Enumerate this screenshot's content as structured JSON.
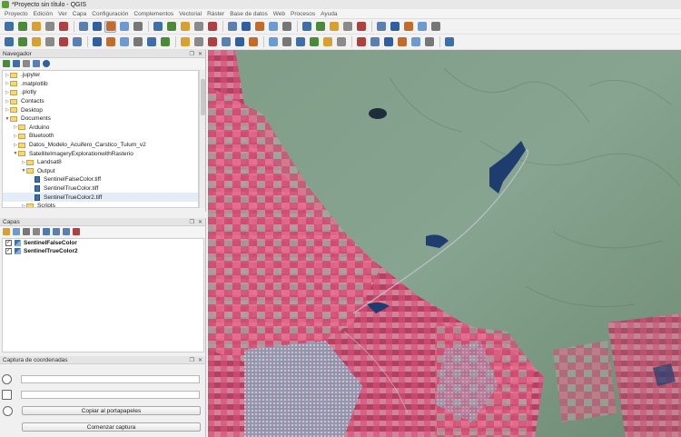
{
  "window": {
    "title": "*Proyecto sin título - QGIS"
  },
  "menubar": {
    "items": [
      "Proyecto",
      "Edición",
      "Ver",
      "Capa",
      "Configuración",
      "Complementos",
      "Vectorial",
      "Ráster",
      "Base de datos",
      "Web",
      "Procesos",
      "Ayuda"
    ]
  },
  "toolbar_primary": {
    "icons": [
      "new-project-icon",
      "open-project-icon",
      "save-project-icon",
      "save-as-icon",
      "print-layout-icon",
      "layout-manager-icon",
      "style-manager-icon",
      "pan-icon",
      "pan-to-selection-icon",
      "zoom-in-icon",
      "zoom-out-icon",
      "zoom-full-icon",
      "zoom-selection-icon",
      "zoom-layer-icon",
      "zoom-native-icon",
      "zoom-last-icon",
      "zoom-next-icon",
      "new-bookmark-icon",
      "show-bookmarks-icon",
      "refresh-icon",
      "identify-icon",
      "select-icon",
      "deselect-icon",
      "attribute-table-icon",
      "field-calculator-icon",
      "statistics-icon",
      "measure-icon",
      "map-tips-icon",
      "annotation-icon",
      "text-annotation-icon"
    ]
  },
  "toolbar_secondary": {
    "icons": [
      "data-source-manager-icon",
      "new-layer-icon",
      "add-vector-icon",
      "add-raster-icon",
      "add-csv-icon",
      "add-spatialite-icon",
      "add-postgis-icon",
      "add-wms-icon",
      "add-wfs-icon",
      "digitize-icon",
      "edit-toggle-icon",
      "save-edits-icon",
      "add-feature-icon",
      "move-feature-icon",
      "node-tool-icon",
      "delete-icon",
      "cut-icon",
      "copy-icon",
      "paste-icon",
      "undo-icon",
      "redo-icon",
      "label-icon",
      "pin-label-icon",
      "show-label-icon",
      "move-label-icon",
      "rotate-label-icon",
      "change-label-icon",
      "python-icon",
      "georeferencer-icon",
      "help-icon",
      "about-icon"
    ]
  },
  "navigator": {
    "title": "Navegador",
    "items": [
      {
        "label": ".jupyter",
        "level": 1,
        "type": "folder",
        "expanded": false
      },
      {
        "label": ".matplotlib",
        "level": 1,
        "type": "folder",
        "expanded": false
      },
      {
        "label": ".plotly",
        "level": 1,
        "type": "folder",
        "expanded": false
      },
      {
        "label": "Contacts",
        "level": 1,
        "type": "folder",
        "expanded": false
      },
      {
        "label": "Desktop",
        "level": 1,
        "type": "folder",
        "expanded": false
      },
      {
        "label": "Documents",
        "level": 1,
        "type": "folder",
        "expanded": true
      },
      {
        "label": "Arduino",
        "level": 2,
        "type": "folder",
        "expanded": false
      },
      {
        "label": "Bluetooth",
        "level": 2,
        "type": "folder",
        "expanded": false
      },
      {
        "label": "Datos_Modelo_Acuifero_Carstico_Tulum_v2",
        "level": 2,
        "type": "folder",
        "expanded": false
      },
      {
        "label": "SatelliteImageryExplorationwithRasterio",
        "level": 2,
        "type": "folder",
        "expanded": true
      },
      {
        "label": "Landsat8",
        "level": 3,
        "type": "folder",
        "expanded": false
      },
      {
        "label": "Output",
        "level": 3,
        "type": "folder",
        "expanded": true
      },
      {
        "label": "SentinelFalseColor.tiff",
        "level": 4,
        "type": "file",
        "expanded": false
      },
      {
        "label": "SentinelTrueColor.tiff",
        "level": 4,
        "type": "file",
        "expanded": false
      },
      {
        "label": "SentinelTrueColor2.tiff",
        "level": 4,
        "type": "file",
        "expanded": false,
        "selected": true
      },
      {
        "label": "Scripts",
        "level": 3,
        "type": "folder",
        "expanded": false
      }
    ]
  },
  "layers": {
    "title": "Capas",
    "items": [
      {
        "label": "SentinelFalseColor",
        "checked": true
      },
      {
        "label": "SentinelTrueColor2",
        "checked": true
      }
    ]
  },
  "coordinates": {
    "title": "Captura de coordenadas",
    "copy_button": "Copiar al portapapeles",
    "capture_button": "Comenzar captura"
  },
  "colors": {
    "map_vegetation": "#d9476f",
    "map_terrain": "#7a9a82",
    "map_water": "#1f3c6e",
    "accent": "#3e6fa8"
  }
}
